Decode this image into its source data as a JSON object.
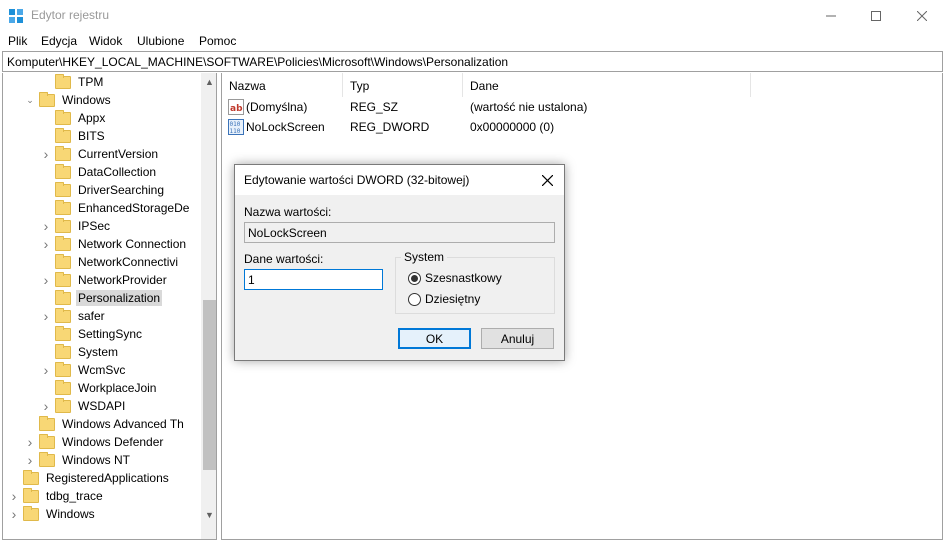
{
  "window": {
    "title": "Edytor rejestru"
  },
  "menu": [
    "Plik",
    "Edycja",
    "Widok",
    "Ulubione",
    "Pomoc"
  ],
  "address": "Komputer\\HKEY_LOCAL_MACHINE\\SOFTWARE\\Policies\\Microsoft\\Windows\\Personalization",
  "tree": [
    {
      "label": "TPM",
      "expander": "",
      "selected": false
    },
    {
      "label": "Windows",
      "expander": "open",
      "selected": false
    },
    {
      "label": "Appx",
      "expander": "",
      "selected": false
    },
    {
      "label": "BITS",
      "expander": "",
      "selected": false
    },
    {
      "label": "CurrentVersion",
      "expander": "closed",
      "selected": false
    },
    {
      "label": "DataCollection",
      "expander": "",
      "selected": false
    },
    {
      "label": "DriverSearching",
      "expander": "",
      "selected": false
    },
    {
      "label": "EnhancedStorageDe",
      "expander": "",
      "selected": false
    },
    {
      "label": "IPSec",
      "expander": "closed",
      "selected": false
    },
    {
      "label": "Network Connection",
      "expander": "closed",
      "selected": false
    },
    {
      "label": "NetworkConnectivi",
      "expander": "",
      "selected": false
    },
    {
      "label": "NetworkProvider",
      "expander": "closed",
      "selected": false
    },
    {
      "label": "Personalization",
      "expander": "",
      "selected": true
    },
    {
      "label": "safer",
      "expander": "closed",
      "selected": false
    },
    {
      "label": "SettingSync",
      "expander": "",
      "selected": false
    },
    {
      "label": "System",
      "expander": "",
      "selected": false
    },
    {
      "label": "WcmSvc",
      "expander": "closed",
      "selected": false
    },
    {
      "label": "WorkplaceJoin",
      "expander": "",
      "selected": false
    },
    {
      "label": "WSDAPI",
      "expander": "closed",
      "selected": false
    },
    {
      "label": "Windows Advanced Th",
      "expander": "",
      "selected": false
    },
    {
      "label": "Windows Defender",
      "expander": "closed",
      "selected": false
    },
    {
      "label": "Windows NT",
      "expander": "closed",
      "selected": false
    },
    {
      "label": "RegisteredApplications",
      "expander": "",
      "selected": false
    },
    {
      "label": "tdbg_trace",
      "expander": "closed",
      "selected": false
    },
    {
      "label": "Windows",
      "expander": "closed",
      "selected": false
    }
  ],
  "list": {
    "columns": [
      "Nazwa",
      "Typ",
      "Dane"
    ],
    "rows": [
      {
        "icon": "string-value-icon",
        "name": "(Domyślna)",
        "type": "REG_SZ",
        "data": "(wartość nie ustalona)"
      },
      {
        "icon": "binary-value-icon",
        "name": "NoLockScreen",
        "type": "REG_DWORD",
        "data": "0x00000000 (0)"
      }
    ]
  },
  "dialog": {
    "title": "Edytowanie wartości DWORD (32-bitowej)",
    "name_label": "Nazwa wartości:",
    "name_value": "NoLockScreen",
    "data_label": "Dane wartości:",
    "data_value": "1",
    "base_group": "System",
    "base_hex": "Szesnastkowy",
    "base_dec": "Dziesiętny",
    "base_selected": "hex",
    "ok": "OK",
    "cancel": "Anuluj"
  },
  "colors": {
    "accent": "#0078d7",
    "folder": "#f8d775",
    "selection": "#d9d9d9"
  }
}
